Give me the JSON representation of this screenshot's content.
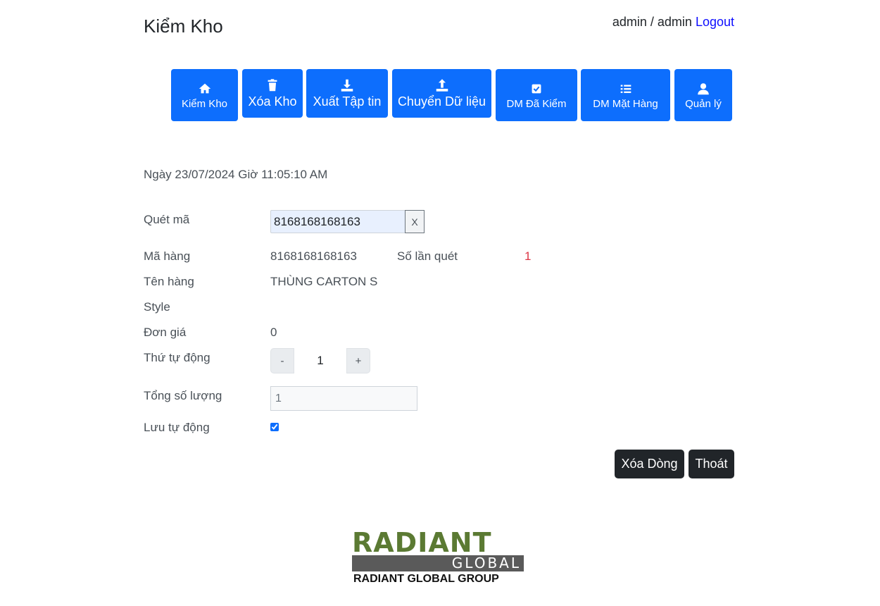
{
  "header": {
    "title": "Kiểm Kho",
    "user": "admin / admin",
    "logout_label": "Logout"
  },
  "toolbar": {
    "buttons": [
      {
        "label": "Kiểm Kho",
        "icon": "home-icon"
      },
      {
        "label": "Xóa Kho",
        "icon": "trash-icon"
      },
      {
        "label": "Xuất Tập tin",
        "icon": "download-icon"
      },
      {
        "label": "Chuyển Dữ liệu",
        "icon": "upload-icon"
      },
      {
        "label": "DM Đã Kiểm",
        "icon": "check-square-icon"
      },
      {
        "label": "DM Mặt Hàng",
        "icon": "list-icon"
      },
      {
        "label": "Quản lý",
        "icon": "user-icon"
      }
    ],
    "color": "#0d6efd"
  },
  "datetime": "Ngày 23/07/2024 Giờ 11:05:10 AM",
  "form": {
    "scan_label": "Quét mã",
    "scan_value": "8168168168163",
    "scan_clear_label": "X",
    "item_code_label": "Mã hàng",
    "item_code_value": "8168168168163",
    "scan_count_label": "Số lần quét",
    "scan_count_value": "1",
    "scan_count_color": "#dc3545",
    "item_name_label": "Tên hàng",
    "item_name_value": "THÙNG CARTON S",
    "style_label": "Style",
    "style_value": "",
    "unit_price_label": "Đơn giá",
    "unit_price_value": "0",
    "auto_order_label": "Thứ tự động",
    "auto_order_minus": "-",
    "auto_order_value": "1",
    "auto_order_plus": "+",
    "total_qty_label": "Tổng số lượng",
    "total_qty_value": "1",
    "autosave_label": "Lưu tự động",
    "autosave_checked": true
  },
  "actions": {
    "delete_row_label": "Xóa Dòng",
    "exit_label": "Thoát"
  },
  "logo": {
    "top_text": "RADIANT",
    "bar_text": "GLOBAL",
    "caption": "RADIANT GLOBAL GROUP",
    "green": "#5b7a33",
    "gray": "#5a5a5a"
  }
}
